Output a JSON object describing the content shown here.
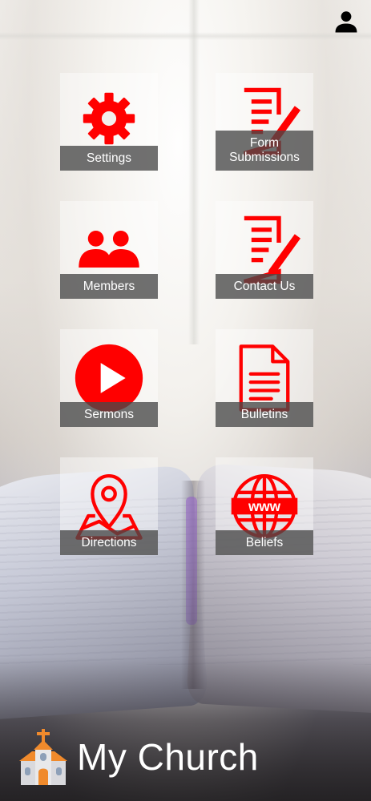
{
  "header": {
    "profile_icon": "person-icon"
  },
  "tiles": [
    {
      "label": "Settings",
      "icon": "gear-icon"
    },
    {
      "label": "Form Submissions",
      "icon": "edit-document-icon"
    },
    {
      "label": "Members",
      "icon": "group-icon"
    },
    {
      "label": "Contact Us",
      "icon": "edit-document-icon"
    },
    {
      "label": "Sermons",
      "icon": "play-circle-icon"
    },
    {
      "label": "Bulletins",
      "icon": "document-icon"
    },
    {
      "label": "Directions",
      "icon": "map-pin-icon"
    },
    {
      "label": "Beliefs",
      "icon": "globe-www-icon"
    }
  ],
  "footer": {
    "app_name": "My Church",
    "logo_icon": "church-icon"
  },
  "colors": {
    "icon_red": "#ff0000",
    "label_bar": "#484848",
    "label_text": "#ffffff"
  }
}
